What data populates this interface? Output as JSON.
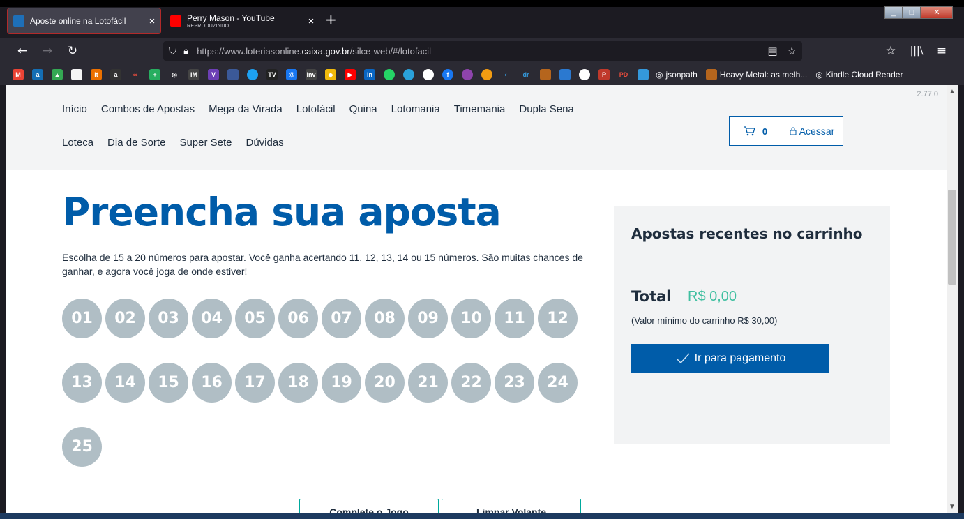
{
  "browser": {
    "tabs": [
      {
        "title": "Aposte online na Lotofácil",
        "subtitle": "",
        "active": true,
        "favicon_color": "#1e6fb8"
      },
      {
        "title": "Perry Mason - YouTube",
        "subtitle": "REPRODUZINDO",
        "active": false,
        "favicon_color": "#ff0000"
      }
    ],
    "new_tab_label": "+",
    "url_prefix": "https://www.loteriasonline.",
    "url_domain": "caixa.gov.br",
    "url_path": "/silce-web/#/lotofacil",
    "bookmarks_text": [
      "jsonpath",
      "Heavy Metal: as melh...",
      "Kindle Cloud Reader"
    ]
  },
  "site": {
    "version": "2.77.0",
    "menu_row1": [
      "Início",
      "Combos de Apostas",
      "Mega da Virada",
      "Lotofácil",
      "Quina",
      "Lotomania",
      "Timemania",
      "Dupla Sena"
    ],
    "menu_row2": [
      "Loteca",
      "Dia de Sorte",
      "Super Sete",
      "Dúvidas"
    ],
    "cart_count": "0",
    "login_label": "Acessar"
  },
  "main": {
    "title": "Preencha sua aposta",
    "description": "Escolha de 15 a 20 números para apostar. Você ganha acertando 11, 12, 13, 14 ou 15 números. São muitas chances de ganhar, e agora você joga de onde estiver!",
    "numbers": [
      "01",
      "02",
      "03",
      "04",
      "05",
      "06",
      "07",
      "08",
      "09",
      "10",
      "11",
      "12",
      "13",
      "14",
      "15",
      "16",
      "17",
      "18",
      "19",
      "20",
      "21",
      "22",
      "23",
      "24",
      "25"
    ],
    "complete_button": "Complete o Jogo",
    "clear_button": "Limpar Volante"
  },
  "cart_panel": {
    "heading": "Apostas recentes no carrinho",
    "total_label": "Total",
    "total_value": "R$ 0,00",
    "minimum_note": "(Valor mínimo do carrinho R$ 30,00)",
    "pay_button": "Ir para pagamento"
  },
  "colors": {
    "brand_blue": "#005ca9",
    "ball_gray": "#b0bec5",
    "total_green": "#3fbfa0"
  }
}
